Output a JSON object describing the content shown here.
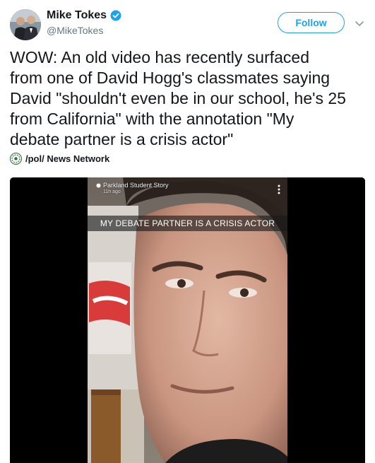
{
  "user": {
    "display_name": "Mike Tokes",
    "handle": "@MikeTokes",
    "verified_icon": "verified-badge-icon",
    "avatar": "avatar"
  },
  "header": {
    "follow_label": "Follow",
    "menu_icon": "chevron-down-icon"
  },
  "tweet": {
    "text": "WOW: An old video has recently surfaced\nfrom one of David Hogg's classmates saying\nDavid \"shouldn't even be in our school, he's 25\nfrom California\" with the annotation \"My\ndebate partner is a crisis actor\""
  },
  "source": {
    "label": "/pol/ News Network",
    "icon": "globe-icon"
  },
  "media": {
    "story_name": "Parkland Student Story",
    "story_time": "11h ago",
    "caption": "MY DEBATE PARTNER IS A CRISIS ACTOR",
    "menu_icon": "more-vertical-icon"
  },
  "colors": {
    "accent": "#1da1f2",
    "text": "#14171a",
    "muted": "#657786",
    "media_background": "#000000"
  }
}
